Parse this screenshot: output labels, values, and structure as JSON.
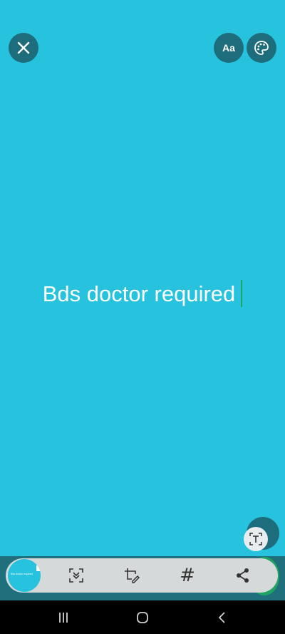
{
  "app": {
    "status_text": "Bds doctor required"
  },
  "top_bar": {
    "font_button_label": "Aa"
  },
  "toolbar": {
    "thumbnail_text": "Bds doctor required",
    "hashtag_glyph": "#"
  },
  "colors": {
    "canvas_background": "#27c2de",
    "button_background": "#1d6d7d",
    "cursor_color": "#1fa463",
    "toolbar_background": "#d6d9da"
  },
  "icons": [
    "close-icon",
    "palette-icon",
    "text-detect-icon",
    "hd-icon",
    "crop-edit-icon",
    "hashtag-icon",
    "share-icon",
    "recents-icon",
    "home-icon",
    "back-icon"
  ]
}
